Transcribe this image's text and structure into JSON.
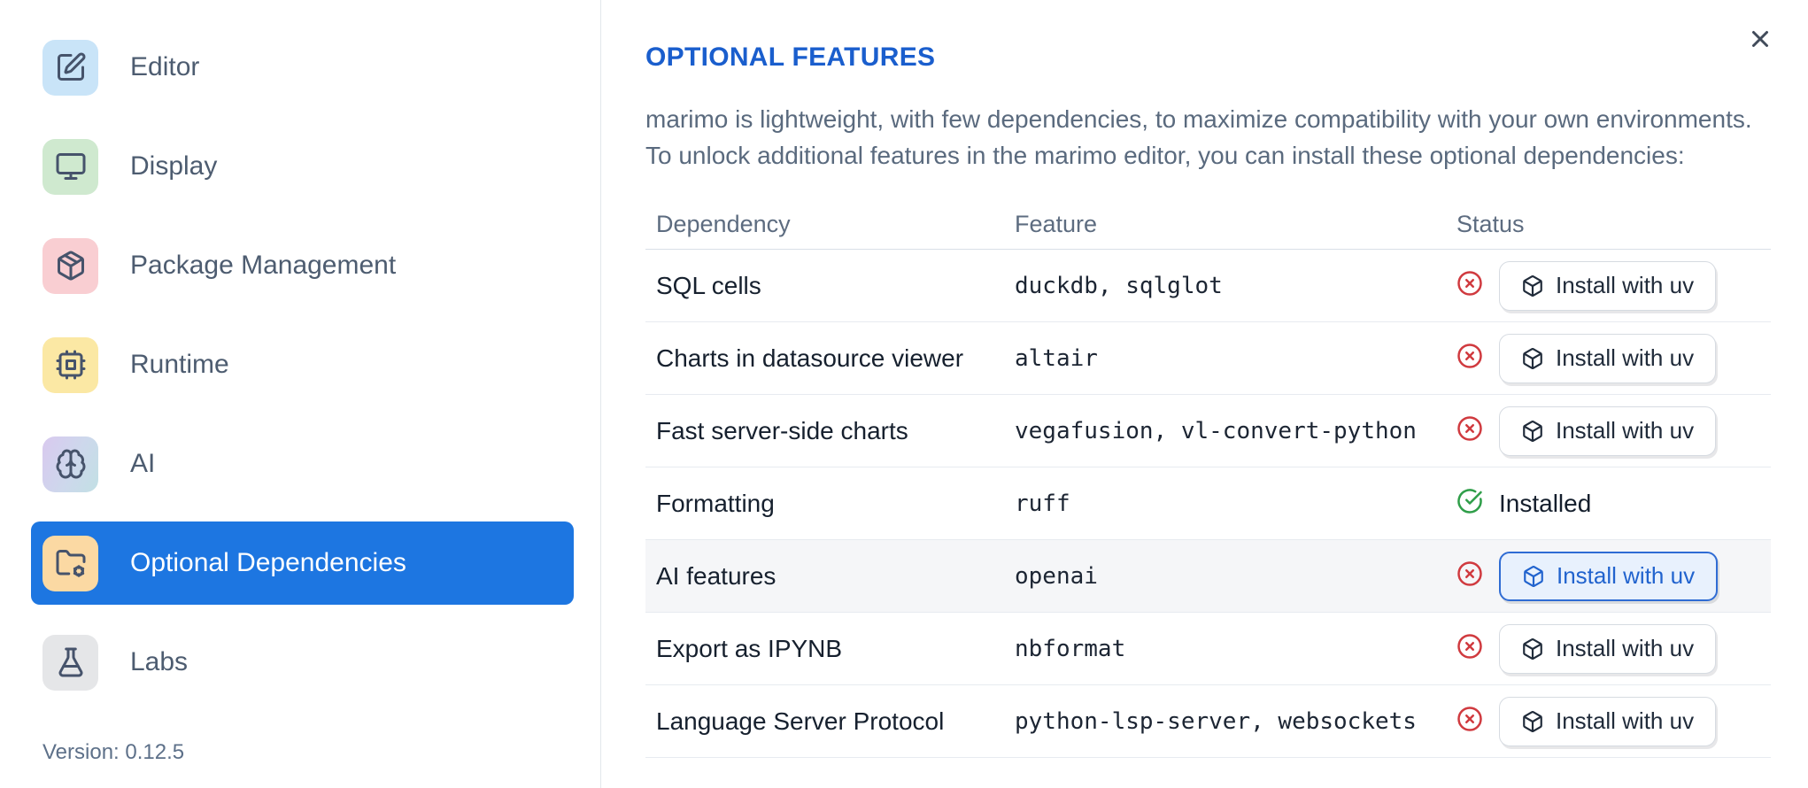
{
  "sidebar": {
    "items": [
      {
        "label": "Editor",
        "slug": "editor",
        "icon": "square-pen",
        "tile_bg": "#c9e4f8",
        "selected": false
      },
      {
        "label": "Display",
        "slug": "display",
        "icon": "monitor",
        "tile_bg": "#cfe9cf",
        "selected": false
      },
      {
        "label": "Package Management",
        "slug": "package-management",
        "icon": "package",
        "tile_bg": "#f9ced2",
        "selected": false
      },
      {
        "label": "Runtime",
        "slug": "runtime",
        "icon": "cpu",
        "tile_bg": "#fbe8a4",
        "selected": false
      },
      {
        "label": "AI",
        "slug": "ai",
        "icon": "brain",
        "tile_bg": "linear-gradient(115deg,#d9c9ef 0%,#cdd8ec 55%,#c2e0e4 100%)",
        "selected": false
      },
      {
        "label": "Optional Dependencies",
        "slug": "optional-dependencies",
        "icon": "folder-cog",
        "tile_bg": "#fbd9a3",
        "selected": true
      },
      {
        "label": "Labs",
        "slug": "labs",
        "icon": "flask",
        "tile_bg": "#e5e6e8",
        "selected": false
      }
    ],
    "version": "Version: 0.12.5"
  },
  "panel": {
    "title": "OPTIONAL FEATURES",
    "description_line1": "marimo is lightweight, with few dependencies, to maximize compatibility with your own environments.",
    "description_line2": "To unlock additional features in the marimo editor, you can install these optional dependencies:",
    "close_icon": "x"
  },
  "table": {
    "headers": {
      "dependency": "Dependency",
      "feature": "Feature",
      "status": "Status"
    },
    "installed_label": "Installed",
    "install_button_label": "Install with uv",
    "rows": [
      {
        "dependency": "SQL cells",
        "feature": "duckdb, sqlglot",
        "installed": false,
        "highlighted": false
      },
      {
        "dependency": "Charts in datasource viewer",
        "feature": "altair",
        "installed": false,
        "highlighted": false
      },
      {
        "dependency": "Fast server-side charts",
        "feature": "vegafusion, vl-convert-python",
        "installed": false,
        "highlighted": false
      },
      {
        "dependency": "Formatting",
        "feature": "ruff",
        "installed": true,
        "highlighted": false
      },
      {
        "dependency": "AI features",
        "feature": "openai",
        "installed": false,
        "highlighted": true
      },
      {
        "dependency": "Export as IPYNB",
        "feature": "nbformat",
        "installed": false,
        "highlighted": false
      },
      {
        "dependency": "Language Server Protocol",
        "feature": "python-lsp-server, websockets",
        "installed": false,
        "highlighted": false
      }
    ]
  },
  "colors": {
    "selection_blue": "#1d76e1",
    "title_blue": "#1a5ecd",
    "primary_button_blue": "#2163ce",
    "primary_button_bg": "#e8f1fd",
    "not_installed_red": "#d03a3f",
    "installed_green": "#2f9e49",
    "text_primary": "#16202e",
    "text_secondary": "#5a6a7e",
    "divider": "#e2e7ec"
  }
}
